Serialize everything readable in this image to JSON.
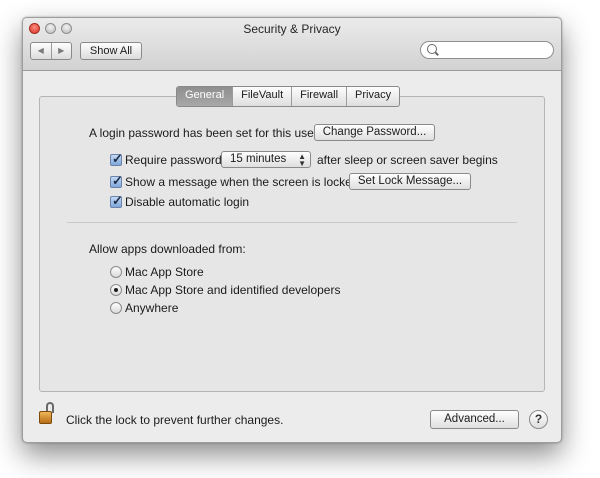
{
  "window": {
    "title": "Security & Privacy",
    "nav": {
      "back": "◀",
      "forward": "▶"
    },
    "show_all_label": "Show All",
    "search": {
      "placeholder": "",
      "value": ""
    }
  },
  "tabs": [
    {
      "label": "General",
      "active": true
    },
    {
      "label": "FileVault",
      "active": false
    },
    {
      "label": "Firewall",
      "active": false
    },
    {
      "label": "Privacy",
      "active": false
    }
  ],
  "general": {
    "login_password_text": "A login password has been set for this user",
    "change_password_label": "Change Password...",
    "require_password": {
      "checked": true,
      "label": "Require password",
      "delay_value": "15 minutes",
      "suffix": "after sleep or screen saver begins"
    },
    "show_message": {
      "checked": true,
      "label": "Show a message when the screen is locked",
      "button_label": "Set Lock Message..."
    },
    "disable_auto_login": {
      "checked": true,
      "label": "Disable automatic login"
    },
    "allow_apps": {
      "heading": "Allow apps downloaded from:",
      "options": [
        {
          "label": "Mac App Store",
          "selected": false
        },
        {
          "label": "Mac App Store and identified developers",
          "selected": true
        },
        {
          "label": "Anywhere",
          "selected": false
        }
      ]
    }
  },
  "footer": {
    "lock_text": "Click the lock to prevent further changes.",
    "advanced_label": "Advanced...",
    "help_label": "?"
  },
  "icons": [
    "close-icon",
    "minimize-icon",
    "zoom-icon",
    "search-icon",
    "lock-icon",
    "help-icon"
  ],
  "colors": {
    "active_tab": "#9a9a9a",
    "checkbox_fill": "#7ea7dc",
    "lock": "#d18a2a"
  }
}
